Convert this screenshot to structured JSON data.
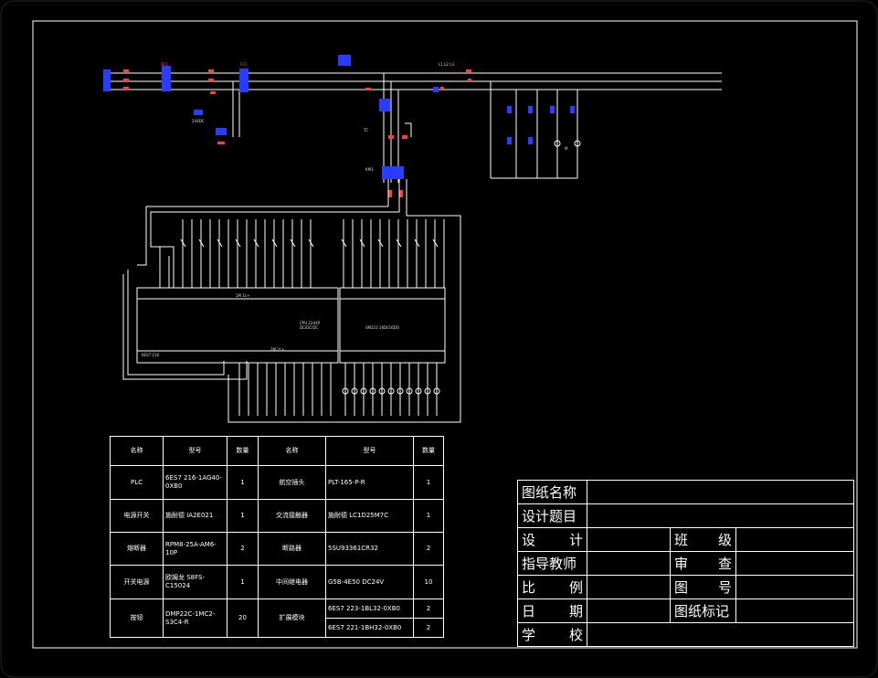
{
  "colors": {
    "background": "#000000",
    "frame": "#ffffff",
    "wire": "#ffffff",
    "label_red": "#ff3b3b",
    "component_blue": "#2a3cff"
  },
  "bom": {
    "headers": [
      "名称",
      "型号",
      "数量",
      "名称",
      "型号",
      "数量"
    ],
    "rows": [
      [
        "PLC",
        "6ES7 216-1AG40-0XB0",
        "1",
        "航空插头",
        "PLT-165-P-R",
        "1"
      ],
      [
        "电源开关",
        "施耐德 IA2E021",
        "1",
        "交流接触器",
        "施耐德 LC1D25M7C",
        "1"
      ],
      [
        "熔断器",
        "RPM8-25A-AM6-10P",
        "2",
        "断路器",
        "5SU93361CR32",
        "2"
      ],
      [
        "开关电源",
        "欧姆龙 S8FS-C15024",
        "1",
        "中间继电器",
        "G5B-4E50 DC24V",
        "10"
      ],
      [
        "按钮",
        "DMP22C-1MC2-S3C4-R",
        "20",
        "扩展模块",
        "6ES7 223-1BL32-0XB0",
        "2"
      ]
    ],
    "extra_row": [
      "",
      "",
      "",
      "",
      "6ES7 221-1BH32-0XB0",
      "2"
    ]
  },
  "title_block": {
    "drawing_name": "图纸名称",
    "design_topic": "设计题目",
    "designer": "设  计",
    "class": "班  级",
    "instructor": "指导教师",
    "review": "审  查",
    "scale": "比  例",
    "drawing_no": "图  号",
    "date": "日  期",
    "drawing_mark": "图纸标记",
    "school": "学  校"
  },
  "schematic": {
    "plc_main_label": "CPU 224XP",
    "plc_sub_label": "DC/DC/DC",
    "ext_module_label": "SM223 16DI/16DO",
    "cpu_model": "6ES7 216",
    "terminal_top": "1M 1L+",
    "terminal_bottom": "2M 2L+",
    "power_label": "L1 L2 L3",
    "contactor_label": "KM1",
    "breaker_label": "QF1",
    "fuse_label": "FU1",
    "psu_label": "24VDC",
    "transformer_label": "TC",
    "motor_label": "M"
  }
}
